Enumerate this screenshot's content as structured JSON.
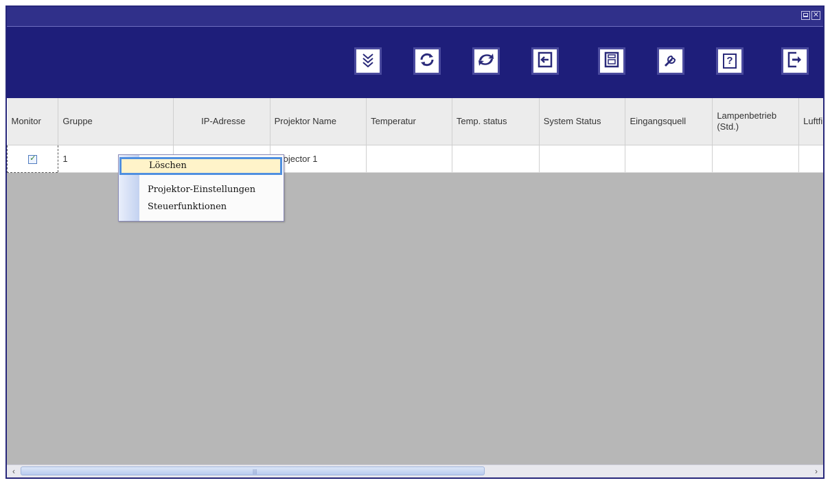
{
  "window": {
    "controls": {
      "minimize": "minimize-icon",
      "close": "close-icon",
      "close_glyph": "✕"
    }
  },
  "toolbar": {
    "buttons": [
      {
        "name": "expand-all-button",
        "icon": "triple-chevron-down-icon"
      },
      {
        "name": "refresh-button",
        "icon": "refresh-icon"
      },
      {
        "name": "reconnect-button",
        "icon": "sync-cycle-icon"
      },
      {
        "name": "import-button",
        "icon": "import-icon"
      },
      {
        "name": "save-button",
        "icon": "floppy-disk-icon"
      },
      {
        "name": "settings-button",
        "icon": "wrench-icon"
      },
      {
        "name": "help-button",
        "icon": "help-icon",
        "glyph": "?"
      },
      {
        "name": "exit-button",
        "icon": "exit-icon"
      }
    ]
  },
  "table": {
    "columns": [
      "Monitor",
      "Gruppe",
      "IP-Adresse",
      "Projektor Name",
      "Temperatur",
      "Temp. status",
      "System Status",
      "Eingangsquell",
      "Lampenbetrieb (Std.)",
      "Luftfilter (St"
    ],
    "rows": [
      {
        "monitor_checked": true,
        "gruppe": "1",
        "ip": "",
        "name": "Projector 1",
        "temperatur": "",
        "temp_status": "",
        "system_status": "",
        "eingang": "",
        "lampe": "",
        "luftfilter": ""
      }
    ]
  },
  "context_menu": {
    "items": [
      "Löschen",
      "Projektor-Einstellungen",
      "Steuerfunktionen"
    ]
  },
  "colors": {
    "toolbar_bg": "#1e1e7a",
    "titlebar_bg": "#30308a",
    "workspace_bg": "#b7b7b7",
    "menu_highlight": "#fff3c9",
    "menu_highlight_border": "#4f8fe0"
  },
  "scrollbar": {
    "left_arrow": "‹",
    "right_arrow": "›"
  }
}
